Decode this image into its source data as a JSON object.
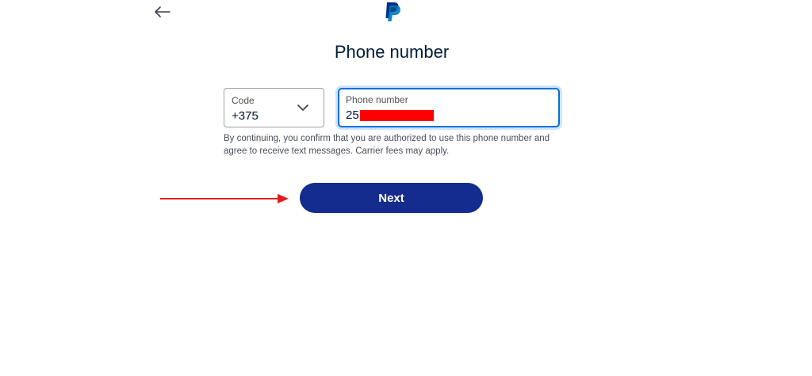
{
  "header": {
    "back_icon": "arrow-left-icon",
    "logo_icon": "paypal-logo-icon"
  },
  "title": "Phone number",
  "code_field": {
    "label": "Code",
    "value": "+375",
    "icon": "chevron-down-icon"
  },
  "phone_field": {
    "label": "Phone number",
    "value_prefix": "25"
  },
  "disclaimer": "By continuing, you confirm that you are authorized to use this phone number and agree to receive text messages. Carrier fees may apply.",
  "next_button": {
    "label": "Next"
  },
  "colors": {
    "primary_button": "#142c8e",
    "focus_border": "#0070e0",
    "annotation_arrow": "#e31b1b",
    "redaction": "#ff0000"
  }
}
